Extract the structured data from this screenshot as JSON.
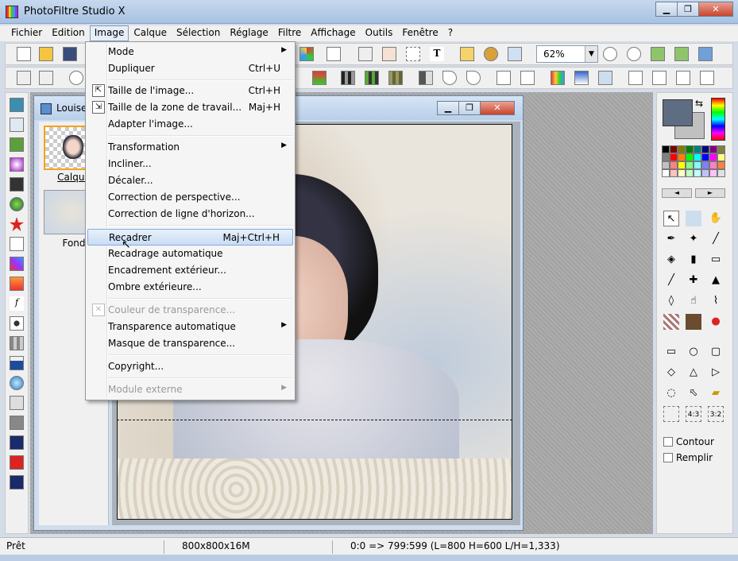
{
  "app": {
    "title": "PhotoFiltre Studio X"
  },
  "window_buttons": {
    "minimize": "▁",
    "maximize": "❐",
    "close": "✕"
  },
  "menubar": [
    "Fichier",
    "Edition",
    "Image",
    "Calque",
    "Sélection",
    "Réglage",
    "Filtre",
    "Affichage",
    "Outils",
    "Fenêtre",
    "?"
  ],
  "toolbar": {
    "zoom_value": "62%",
    "zoom_dropdown": "▼"
  },
  "image_menu": {
    "items": [
      {
        "label": "Mode",
        "shortcut": "",
        "submenu": true
      },
      {
        "label": "Dupliquer",
        "shortcut": "Ctrl+U"
      },
      {
        "label": "Taille de l'image...",
        "shortcut": "Ctrl+H",
        "icon": "image-size-icon"
      },
      {
        "label": "Taille de la zone de travail...",
        "shortcut": "Maj+H",
        "icon": "canvas-size-icon"
      },
      {
        "label": "Adapter l'image...",
        "shortcut": ""
      },
      {
        "label": "Transformation",
        "shortcut": "",
        "submenu": true
      },
      {
        "label": "Incliner...",
        "shortcut": ""
      },
      {
        "label": "Décaler...",
        "shortcut": ""
      },
      {
        "label": "Correction de perspective...",
        "shortcut": ""
      },
      {
        "label": "Correction de ligne d'horizon...",
        "shortcut": ""
      },
      {
        "label": "Recadrer",
        "shortcut": "Maj+Ctrl+H",
        "highlighted": true
      },
      {
        "label": "Recadrage automatique",
        "shortcut": ""
      },
      {
        "label": "Encadrement extérieur...",
        "shortcut": ""
      },
      {
        "label": "Ombre extérieure...",
        "shortcut": ""
      },
      {
        "label": "Couleur de transparence...",
        "shortcut": "",
        "disabled": true,
        "icon": "transparency-color-icon"
      },
      {
        "label": "Transparence automatique",
        "shortcut": "",
        "submenu": true
      },
      {
        "label": "Masque de transparence...",
        "shortcut": ""
      },
      {
        "label": "Copyright...",
        "shortcut": ""
      },
      {
        "label": "Module externe",
        "shortcut": "",
        "disabled": true,
        "submenu": true
      }
    ],
    "submenu_arrow": "▶"
  },
  "document": {
    "title": "Louise_",
    "layers": [
      "Calque",
      "Fond"
    ]
  },
  "right_panel": {
    "swap_icon": "⇆",
    "palette_prev": "◄",
    "palette_next": "►",
    "outline_label": "Contour",
    "fill_label": "Remplir",
    "ratio_43": "4:3",
    "ratio_32": "3:2"
  },
  "status": {
    "state": "Prêt",
    "image_info": "800x800x16M",
    "coords": "0:0 => 799:599 (L=800  H=600  L/H=1,333)"
  }
}
